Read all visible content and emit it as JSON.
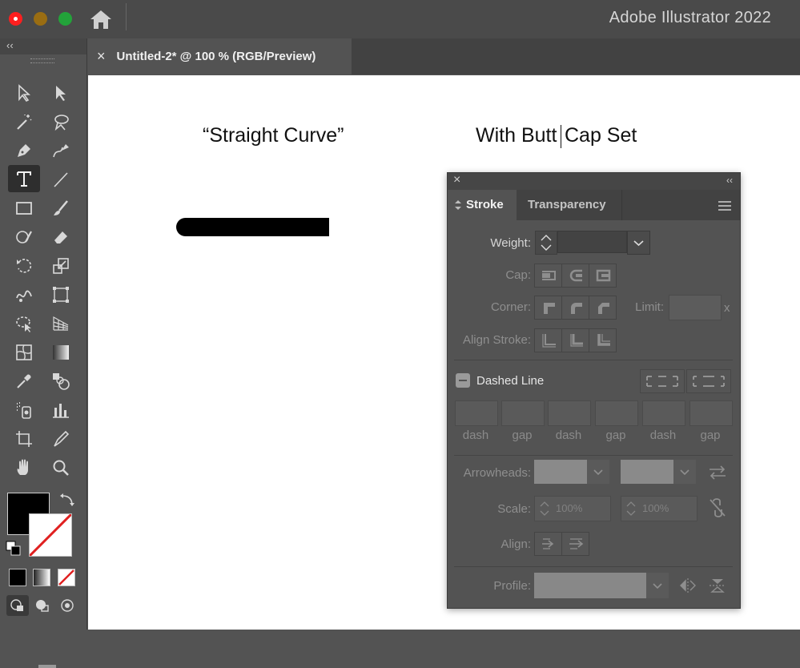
{
  "window": {
    "app_title": "Adobe Illustrator 2022"
  },
  "document_tab": {
    "title": "Untitled-2* @ 100 % (RGB/Preview)",
    "close_glyph": "×"
  },
  "toolbar": {
    "collapse_glyph": "‹‹"
  },
  "canvas": {
    "text_left": "“Straight Curve”",
    "text_right_a": "With Butt",
    "text_right_b": "Cap Set"
  },
  "stroke_panel": {
    "close_glyph": "×",
    "collapse_glyph": "‹‹",
    "tabs": [
      "Stroke",
      "Transparency"
    ],
    "weight_label": "Weight:",
    "weight_value": "",
    "cap_label": "Cap:",
    "corner_label": "Corner:",
    "limit_label": "Limit:",
    "limit_unit": "x",
    "align_stroke_label": "Align Stroke:",
    "dashed_line_label": "Dashed Line",
    "dash_labels": [
      "dash",
      "gap",
      "dash",
      "gap",
      "dash",
      "gap"
    ],
    "arrowheads_label": "Arrowheads:",
    "scale_label": "Scale:",
    "scale_start": "100%",
    "scale_end": "100%",
    "align_label": "Align:",
    "profile_label": "Profile:"
  },
  "colors": {
    "close_light": "#fe5f57",
    "minimize_light": "#8a6a20",
    "zoom_light": "#27a33a",
    "ui_bg": "#535353",
    "canvas_bg": "#ffffff"
  }
}
